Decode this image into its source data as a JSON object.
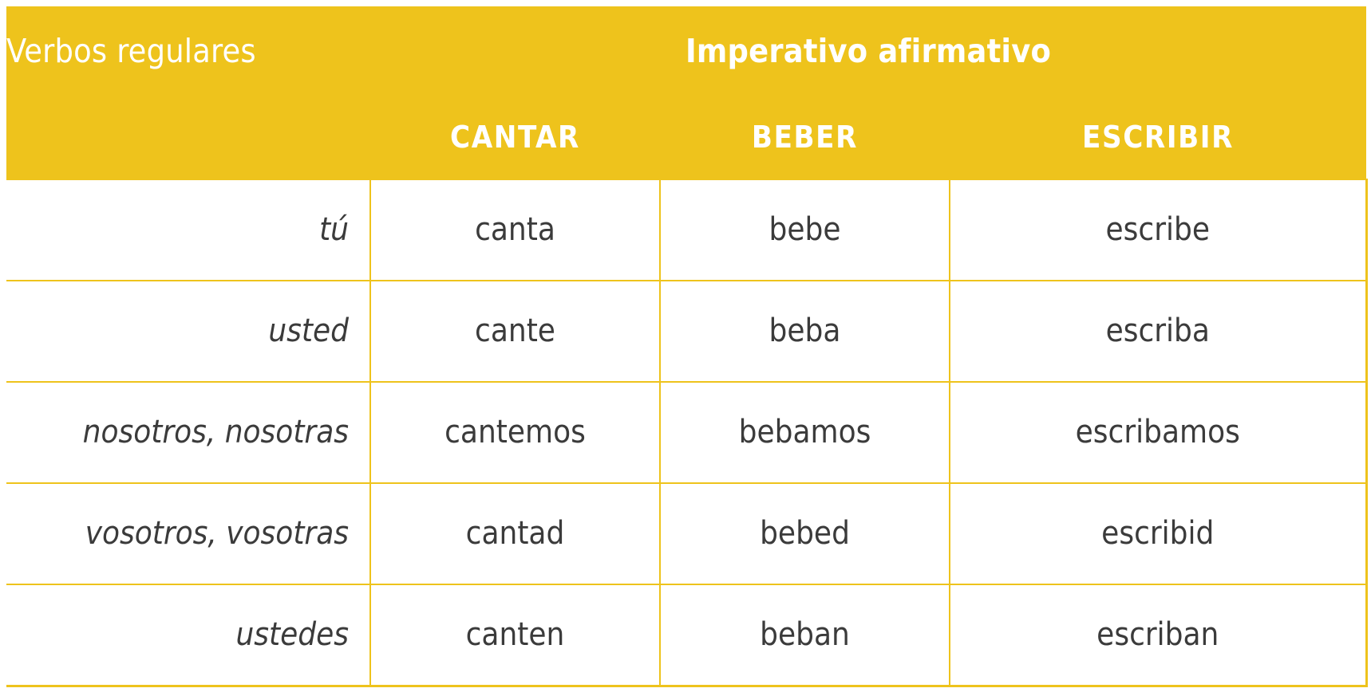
{
  "header": {
    "category_label": "Verbos regulares",
    "title": "Imperativo afirmativo",
    "accent_color": "#EEC31C",
    "header_text_color": "#FFFFFF",
    "body_text_color": "#3B3B3B"
  },
  "table": {
    "columns": [
      "",
      "CANTAR",
      "BEBER",
      "ESCRIBIR"
    ],
    "column_headers": {
      "pronoun": "",
      "verb1": "CANTAR",
      "verb2": "BEBER",
      "verb3": "ESCRIBIR"
    },
    "rows": [
      {
        "pronoun": "tú",
        "cantar": "canta",
        "beber": "bebe",
        "escribir": "escribe"
      },
      {
        "pronoun": "usted",
        "cantar": "cante",
        "beber": "beba",
        "escribir": "escriba"
      },
      {
        "pronoun": "nosotros, nosotras",
        "cantar": "cantemos",
        "beber": "bebamos",
        "escribir": "escribamos"
      },
      {
        "pronoun": "vosotros, vosotras",
        "cantar": "cantad",
        "beber": "bebed",
        "escribir": "escribid"
      },
      {
        "pronoun": "ustedes",
        "cantar": "canten",
        "beber": "beban",
        "escribir": "escriban"
      }
    ]
  }
}
